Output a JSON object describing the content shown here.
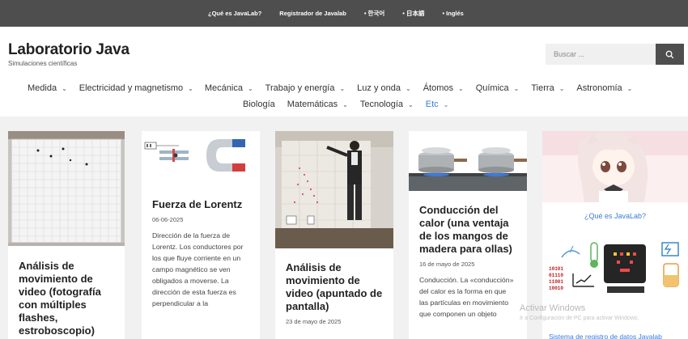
{
  "topbar": {
    "links": [
      "¿Qué es JavaLab?",
      "Registrador de Javalab",
      "• 한국어",
      "• 日本語",
      "• Inglés"
    ]
  },
  "site": {
    "title": "Laboratorio Java",
    "tagline": "Simulaciones científicas"
  },
  "search": {
    "placeholder": "Buscar ..."
  },
  "nav": {
    "row1": [
      "Medida",
      "Electricidad y magnetismo",
      "Mecánica",
      "Trabajo y energía",
      "Luz y onda",
      "Átomos",
      "Química",
      "Tierra",
      "Astronomía"
    ],
    "row2": [
      "Biología",
      "Matemáticas",
      "Tecnología",
      "Etc"
    ]
  },
  "cards": [
    {
      "title": "Análisis de movimiento de video (fotografía con múltiples flashes, estroboscopio)"
    },
    {
      "title": "Fuerza de Lorentz",
      "date": "06-06-2025",
      "excerpt": "Dirección de la fuerza de Lorentz. Los conductores por los que fluye corriente en un campo magnético se ven obligados a moverse. La dirección de esta fuerza es perpendicular a la"
    },
    {
      "title": "Análisis de movimiento de video (apuntado de pantalla)",
      "date": "23 de mayo de 2025"
    },
    {
      "title": "Conducción del calor (una ventaja de los mangos de madera para ollas)",
      "date": "16 de mayo de 2025",
      "excerpt": "Conducción. La «conducción» del calor es la forma en que las partículas en movimiento que componen un objeto"
    }
  ],
  "sidebar": {
    "javalab_caption": "¿Qué es JavaLab?",
    "logger_caption": "Sistema de registro de datos Javalab",
    "logger_binary": [
      "10101",
      "01110",
      "11001",
      "10010"
    ]
  },
  "watermark": {
    "line1": "Activar Windows",
    "line2": "Ir a Configuración de PC para activar Windows."
  },
  "colors": {
    "topbar": "#4e4e4e",
    "accent": "#3b7bd8",
    "background": "#f1f1f1"
  }
}
